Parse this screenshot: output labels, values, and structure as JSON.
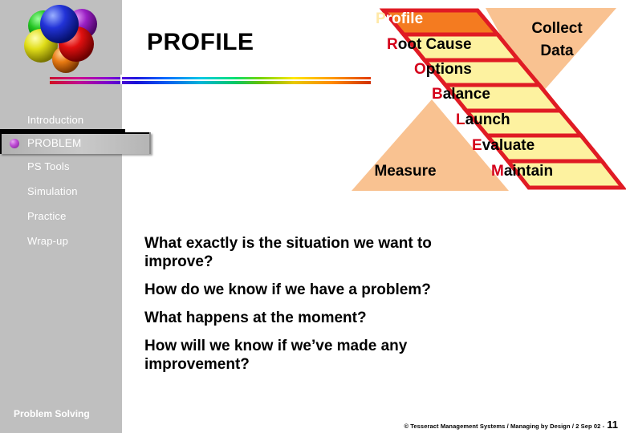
{
  "slide": {
    "title": "PROFILE",
    "sidebar_footer": "Problem Solving"
  },
  "sidebar": {
    "logo_name": "colored-spheres-logo",
    "items": [
      {
        "label": "Introduction",
        "active": false
      },
      {
        "label": "PROBLEM",
        "active": true
      },
      {
        "label": "PS Tools",
        "active": false
      },
      {
        "label": "Simulation",
        "active": false
      },
      {
        "label": "Practice",
        "active": false
      },
      {
        "label": "Wrap-up",
        "active": false
      }
    ]
  },
  "diagram": {
    "name": "problem-solving-process-bands",
    "bands": [
      {
        "cap": "P",
        "rest": "rofile",
        "full": "Profile",
        "fill": "#f47b20",
        "highlight": true
      },
      {
        "cap": "R",
        "rest": "oot Cause",
        "full": "Root Cause",
        "fill": "#fdf2a0",
        "highlight": false
      },
      {
        "cap": "O",
        "rest": "ptions",
        "full": "Options",
        "fill": "#fdf2a0",
        "highlight": false
      },
      {
        "cap": "B",
        "rest": "alance",
        "full": "Balance",
        "fill": "#fdf2a0",
        "highlight": false
      },
      {
        "cap": "L",
        "rest": "aunch",
        "full": "Launch",
        "fill": "#fdf2a0",
        "highlight": false
      },
      {
        "cap": "E",
        "rest": "valuate",
        "full": "Evaluate",
        "fill": "#fdf2a0",
        "highlight": false
      },
      {
        "cap": "M",
        "rest": "aintain",
        "full": "Maintain",
        "fill": "#fdf2a0",
        "highlight": false
      }
    ],
    "side_labels": {
      "top_right_line1": "Collect",
      "top_right_line2": "Data",
      "bottom_left": "Measure"
    },
    "colors": {
      "band_fill": "#fdf2a0",
      "band_highlight_fill": "#f47b20",
      "band_border": "#e01b24",
      "wedge_fill": "#f9c291",
      "cap_letter": "#d4001a"
    }
  },
  "body": {
    "questions": [
      "What exactly is the situation we want to improve?",
      "How do we know if we have a problem?",
      "What happens at the moment?",
      "How will we know if we’ve made any improvement?"
    ]
  },
  "footer": {
    "copyright": "© Tesseract Management Systems / Managing by Design / 2 Sep 02  -",
    "page_number": "11"
  },
  "theme": {
    "sidebar_bg": "#bfbfbf",
    "slide_bg": "#ffffff",
    "text": "#000000",
    "nav_text": "#ffffff",
    "bullet": "#a32bb8"
  }
}
